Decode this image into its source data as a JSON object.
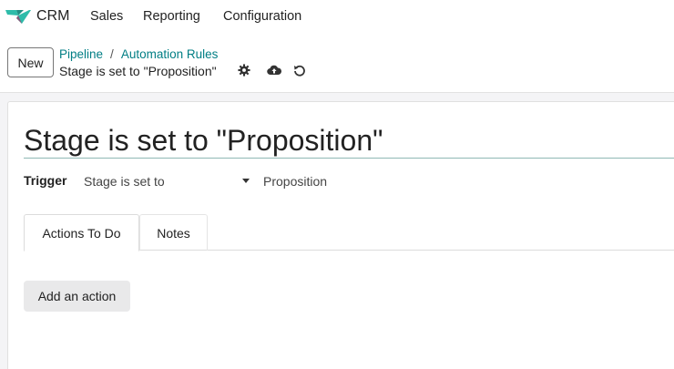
{
  "nav": {
    "app_name": "CRM",
    "menu": [
      "Sales",
      "Reporting",
      "Configuration"
    ],
    "logo_colors": [
      "#2ebcaa",
      "#875a7b"
    ]
  },
  "control_panel": {
    "new_label": "New",
    "breadcrumbs": [
      "Pipeline",
      "Automation Rules"
    ],
    "breadcrumb_separator": "/",
    "record_title": "Stage is set to \"Proposition\"",
    "icons": [
      "gear-icon",
      "cloud-upload-icon",
      "discard-icon"
    ]
  },
  "form": {
    "name": "Stage is set to \"Proposition\"",
    "trigger_label": "Trigger",
    "trigger_value": "Stage is set to",
    "trigger_stage": "Proposition",
    "tabs": [
      {
        "label": "Actions To Do",
        "active": true
      },
      {
        "label": "Notes",
        "active": false
      }
    ],
    "add_action_label": "Add an action"
  },
  "colors": {
    "link": "#017e84",
    "underline": "#8fb9b5"
  }
}
